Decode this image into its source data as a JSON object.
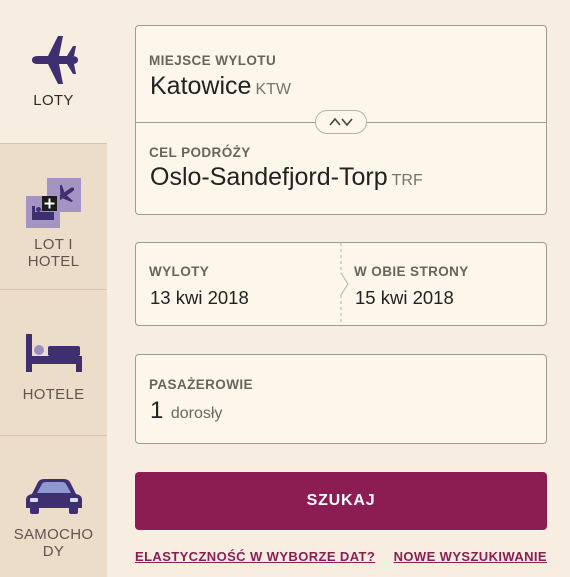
{
  "nav": {
    "flights": "LOTY",
    "flight_hotel": "LOT I HOTEL",
    "hotels": "HOTELE",
    "cars": "SAMOCHO DY"
  },
  "route": {
    "origin_label": "MIEJSCE WYLOTU",
    "origin_city": "Katowice",
    "origin_code": "KTW",
    "destination_label": "CEL PODRÓŻY",
    "destination_city": "Oslo-Sandefjord-Torp",
    "destination_code": "TRF"
  },
  "dates": {
    "departure_label": "WYLOTY",
    "departure_value": "13 kwi 2018",
    "return_label": "W OBIE STRONY",
    "return_value": "15 kwi 2018"
  },
  "passengers": {
    "label": "PASAŻEROWIE",
    "count": "1",
    "type": "dorosły"
  },
  "actions": {
    "search": "SZUKAJ",
    "flexible_dates": "ELASTYCZNOŚĆ W WYBORZE DAT?",
    "new_search": "NOWE WYSZUKIWANIE"
  },
  "colors": {
    "accent": "#8b1d53",
    "icon": "#3e2f70",
    "background": "#f7eee1"
  }
}
